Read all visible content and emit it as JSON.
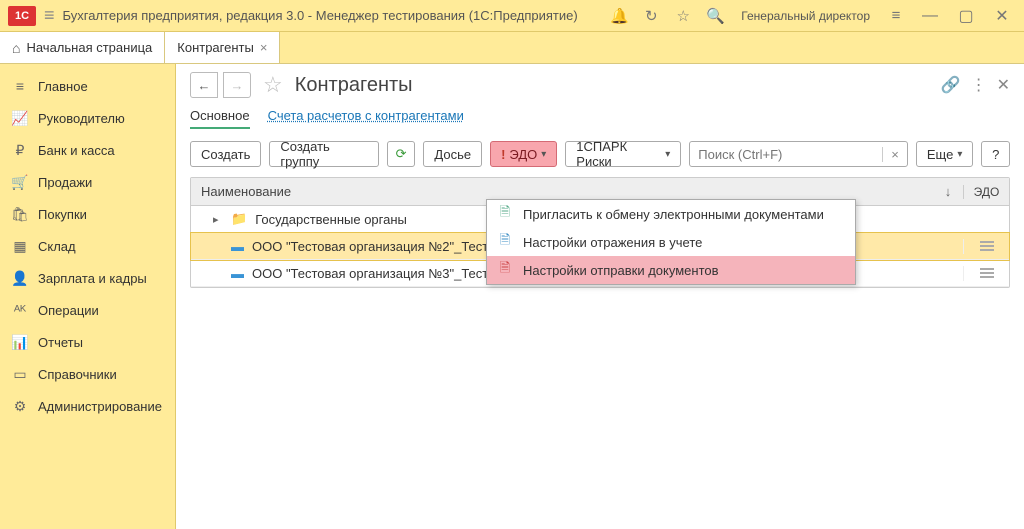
{
  "titlebar": {
    "app_title": "Бухгалтерия предприятия, редакция 3.0  - Менеджер тестирования (1С:Предприятие)",
    "user": "Генеральный директор"
  },
  "tabs": {
    "home": "Начальная страница",
    "current": "Контрагенты"
  },
  "sidebar": [
    {
      "label": "Главное",
      "icon": "≡"
    },
    {
      "label": "Руководителю",
      "icon": "📈"
    },
    {
      "label": "Банк и касса",
      "icon": "₽"
    },
    {
      "label": "Продажи",
      "icon": "🛒"
    },
    {
      "label": "Покупки",
      "icon": "🛍"
    },
    {
      "label": "Склад",
      "icon": "▦"
    },
    {
      "label": "Зарплата и кадры",
      "icon": "👤"
    },
    {
      "label": "Операции",
      "icon": "ᴬᴷ"
    },
    {
      "label": "Отчеты",
      "icon": "📊"
    },
    {
      "label": "Справочники",
      "icon": "▭"
    },
    {
      "label": "Администрирование",
      "icon": "⚙"
    }
  ],
  "page": {
    "title": "Контрагенты",
    "subnav_main": "Основное",
    "subnav_link": "Счета расчетов с контрагентами"
  },
  "toolbar": {
    "create": "Создать",
    "create_group": "Создать группу",
    "dossier": "Досье",
    "edo": "ЭДО",
    "spark": "1СПАРК Риски",
    "search_placeholder": "Поиск (Ctrl+F)",
    "more": "Еще",
    "help": "?"
  },
  "table": {
    "col_name": "Наименование",
    "col_edo": "ЭДО",
    "rows": [
      {
        "type": "folder",
        "label": "Государственные органы"
      },
      {
        "type": "item",
        "label": "ООО \"Тестовая организация №2\"_Тест_",
        "selected": true
      },
      {
        "type": "item",
        "label": "ООО \"Тестовая организация №3\"_Тест_"
      }
    ]
  },
  "dropdown": {
    "items": [
      {
        "label": "Пригласить к обмену электронными документами",
        "highlight": false
      },
      {
        "label": "Настройки отражения в учете",
        "highlight": false
      },
      {
        "label": "Настройки отправки документов",
        "highlight": true
      }
    ]
  }
}
